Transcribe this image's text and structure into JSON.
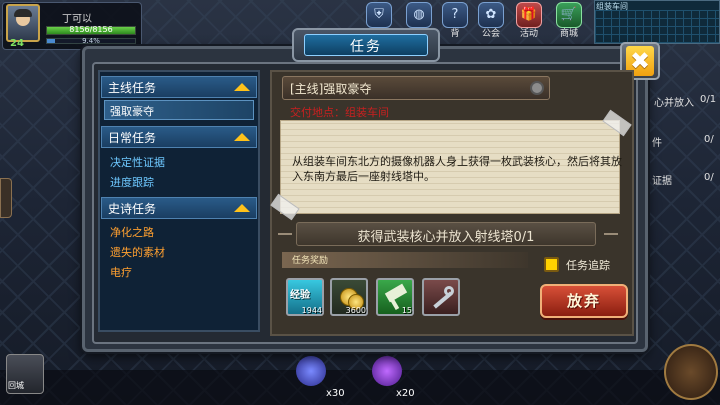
{
  "player": {
    "name": "丁可以",
    "level": "24",
    "hp_text": "8156/8156",
    "exp_text": "9.4%",
    "hp_fraction": 1.0,
    "exp_fraction": 0.094
  },
  "top_menu": [
    {
      "label": "",
      "icon": "shield-icon"
    },
    {
      "label": "",
      "icon": "bag-icon"
    },
    {
      "label": "背",
      "icon": "help-icon"
    },
    {
      "label": "公会",
      "icon": "guild-icon"
    },
    {
      "label": "活动",
      "icon": "event-gift-icon"
    },
    {
      "label": "商城",
      "icon": "shop-cart-icon"
    }
  ],
  "minimap": {
    "label": "组装车间"
  },
  "right_tracker": {
    "line1": "心并放入",
    "line2": "0/1",
    "line3": "件",
    "line4": "证据",
    "line5": "0/",
    "line6": "0/"
  },
  "dialog": {
    "title": "任务",
    "close_label": "✖",
    "categories": [
      {
        "label": "主线任务",
        "items": [
          "强取豪夺"
        ]
      },
      {
        "label": "日常任务",
        "items": [
          "决定性证据",
          "进度跟踪"
        ]
      },
      {
        "label": "史诗任务",
        "items": [
          "净化之路",
          "遗失的素材",
          "电疗"
        ]
      }
    ],
    "quest": {
      "name": "[主线]强取豪夺",
      "location": "交付地点：组装车间",
      "description": "从组装车间东北方的摄像机器人身上获得一枚武装核心，然后将其放入东南方最后一座射线塔中。",
      "objective": "获得武装核心并放入射线塔0/1",
      "reward_label": "任务奖励",
      "rewards": [
        {
          "label": "经验",
          "count": "1944",
          "icon": "exp-icon",
          "color": "#2bb0c8"
        },
        {
          "label": "",
          "count": "3600",
          "icon": "gold-coins-icon",
          "color": "#c8a020"
        },
        {
          "label": "",
          "count": "15",
          "icon": "green-gem-hammer-icon",
          "color": "#2e9a3a"
        },
        {
          "label": "",
          "count": "",
          "icon": "key-icon",
          "color": "#8a4a4a"
        }
      ],
      "track_label": "任务追踪",
      "track_checked": true,
      "abandon_label": "放弃"
    }
  },
  "bottom": {
    "home_label": "回城",
    "skill1_count": "x30",
    "skill2_count": "x20"
  }
}
